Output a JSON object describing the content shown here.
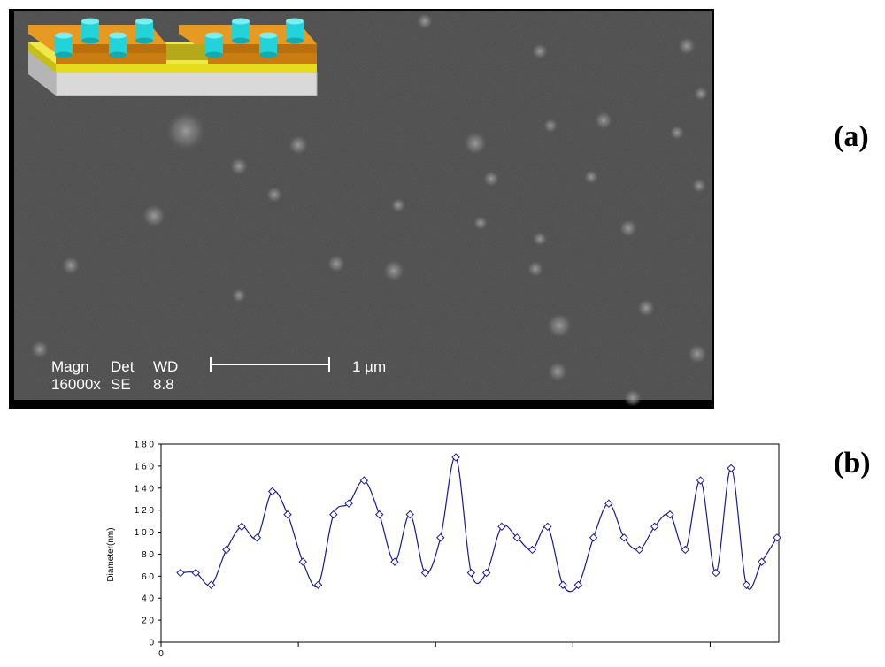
{
  "panels": {
    "a_label": "(a)",
    "b_label": "(b)"
  },
  "sem": {
    "magn_label": "Magn",
    "det_label": "Det",
    "wd_label": "WD",
    "magn_value": "16000x",
    "det_value": "SE",
    "wd_value": "8.8",
    "scale_bar_label": "1 µm"
  },
  "colors": {
    "series": "#1a1a8c",
    "substrate": "#d9d9d9",
    "yellow_layer": "#e6dc1e",
    "orange_layer": "#d98f16",
    "pillars": "#22d4d9"
  },
  "chart_data": {
    "type": "line",
    "title": "",
    "xlabel": "",
    "ylabel": "Diameter(nm)",
    "ylim": [
      0,
      180
    ],
    "yticks": [
      "0",
      "2 0",
      "4 0",
      "6 0",
      "8 0",
      "1 0 0",
      "1 2 0",
      "1 4 0",
      "1 6 0",
      "1 8 0"
    ],
    "xtick_origin_label": "0",
    "grid": false,
    "legend": "none",
    "marker": "diamond",
    "smooth": true,
    "series": [
      {
        "values": [
          63,
          63,
          52,
          84,
          105,
          95,
          137,
          116,
          73,
          52,
          116,
          126,
          147,
          116,
          73,
          116,
          63,
          95,
          168,
          63,
          63,
          105,
          95,
          84,
          105,
          52,
          52,
          95,
          126,
          95,
          84,
          105,
          116,
          84,
          147,
          63,
          158,
          52,
          73,
          95
        ]
      }
    ]
  }
}
